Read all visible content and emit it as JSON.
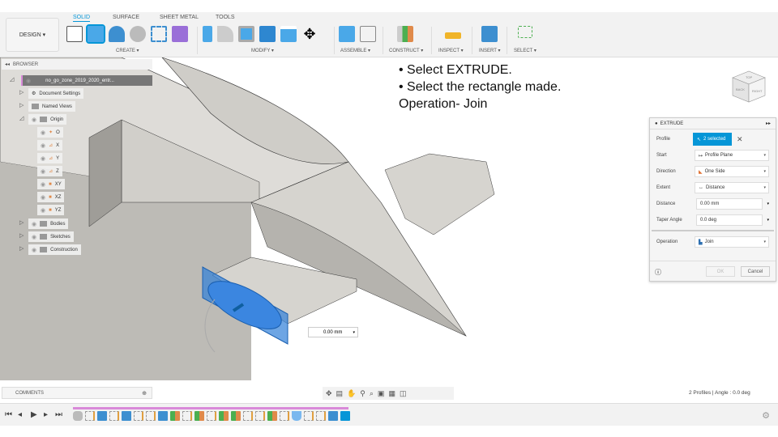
{
  "toolbar": {
    "design": "DESIGN ▾",
    "tabs": [
      "SOLID",
      "SURFACE",
      "SHEET METAL",
      "TOOLS"
    ],
    "groups": [
      "CREATE ▾",
      "MODIFY ▾",
      "ASSEMBLE ▾",
      "CONSTRUCT ▾",
      "INSPECT ▾",
      "INSERT ▾",
      "SELECT ▾"
    ]
  },
  "browser": {
    "title": "BROWSER",
    "root": "no_go_zone_2019_2020_entr...",
    "items": [
      "Document Settings",
      "Named Views",
      "Origin",
      "O",
      "X",
      "Y",
      "Z",
      "XY",
      "XZ",
      "YZ",
      "Bodies",
      "Sketches",
      "Construction"
    ]
  },
  "instructions": [
    "•  Select EXTRUDE.",
    "•  Select the rectangle made.",
    "Operation- Join"
  ],
  "viewcube": {
    "faces": [
      "BACK",
      "RIGHT",
      "TOP"
    ]
  },
  "distance_input": "0.00 mm",
  "extrude": {
    "title": "EXTRUDE",
    "profile_label": "Profile",
    "profile_value": "2 selected",
    "rows": [
      {
        "label": "Start",
        "value": "Profile Plane"
      },
      {
        "label": "Direction",
        "value": "One Side"
      },
      {
        "label": "Extent",
        "value": "Distance"
      },
      {
        "label": "Distance",
        "value": "0.00 mm"
      },
      {
        "label": "Taper Angle",
        "value": "0.0 deg"
      }
    ],
    "operation_label": "Operation",
    "operation_value": "Join",
    "ok": "OK",
    "cancel": "Cancel"
  },
  "comments": "COMMENTS",
  "status": "2 Profiles | Angle : 0.0 deg",
  "timeline": [
    "body",
    "sketch",
    "extrude",
    "sketch",
    "extrude",
    "sketch",
    "sketch",
    "extrude",
    "plane",
    "sketch",
    "plane",
    "sketch",
    "plane",
    "plane",
    "sketch",
    "sketch",
    "plane",
    "sketch",
    "shell",
    "sketch",
    "sketch",
    "extrude",
    "active"
  ],
  "colors": {
    "accent": "#0696d7",
    "timeline_bar": "#d98ad9"
  }
}
